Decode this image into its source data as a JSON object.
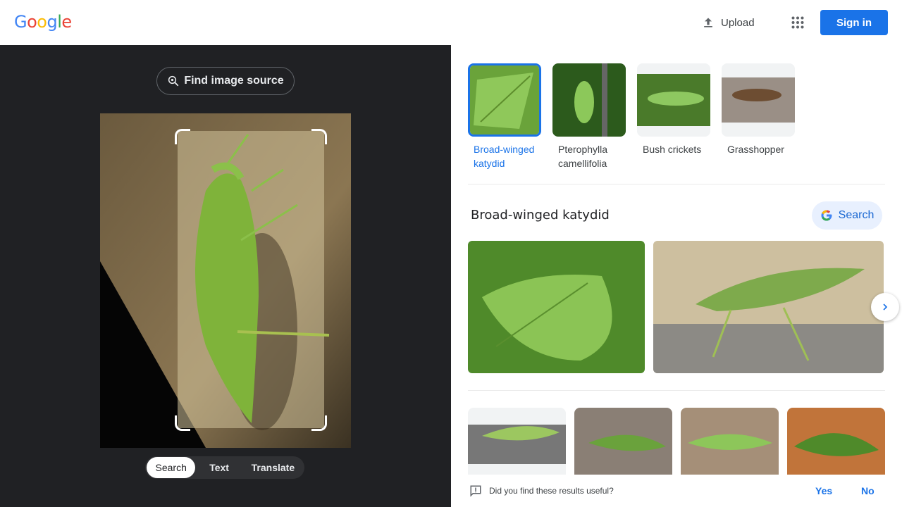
{
  "header": {
    "logo_letters": [
      "G",
      "o",
      "o",
      "g",
      "l",
      "e"
    ],
    "logo_colors": [
      "#4285f4",
      "#ea4335",
      "#fbbc05",
      "#4285f4",
      "#34a853",
      "#ea4335"
    ],
    "upload_label": "Upload",
    "signin_label": "Sign in"
  },
  "left_panel": {
    "find_source_label": "Find image source",
    "modes": [
      "Search",
      "Text",
      "Translate"
    ],
    "active_mode": "Search"
  },
  "results": {
    "chips": [
      {
        "label": "Broad-winged katydid",
        "selected": true
      },
      {
        "label": "Pterophylla camellifolia",
        "selected": false
      },
      {
        "label": "Bush crickets",
        "selected": false
      },
      {
        "label": "Grasshopper",
        "selected": false
      }
    ],
    "section_title": "Broad-winged katydid",
    "search_button_label": "Search"
  },
  "feedback": {
    "question": "Did you find these results useful?",
    "yes_label": "Yes",
    "no_label": "No"
  },
  "colors": {
    "accent": "#1a73e8",
    "dark_panel": "#202124"
  }
}
